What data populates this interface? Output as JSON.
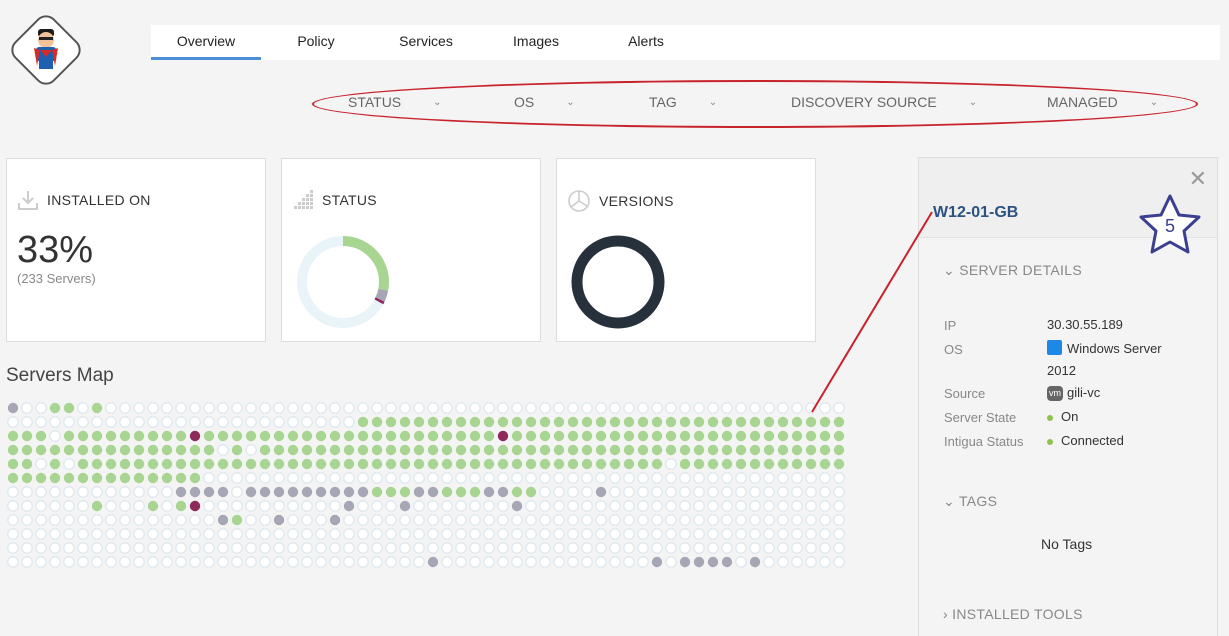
{
  "tabs": [
    {
      "label": "Overview",
      "active": true
    },
    {
      "label": "Policy"
    },
    {
      "label": "Services"
    },
    {
      "label": "Images"
    },
    {
      "label": "Alerts"
    }
  ],
  "filters": [
    {
      "label": "STATUS"
    },
    {
      "label": "OS"
    },
    {
      "label": "TAG"
    },
    {
      "label": "DISCOVERY SOURCE"
    },
    {
      "label": "MANAGED"
    }
  ],
  "cards": {
    "installed": {
      "title": "INSTALLED ON",
      "percent": "33%",
      "servers": "(233 Servers)"
    },
    "status": {
      "title": "STATUS",
      "chart": {
        "green": 0.28,
        "gray": 0.04,
        "purple": 0.01,
        "rest": "#e8f4f7"
      }
    },
    "versions": {
      "title": "VERSIONS"
    }
  },
  "map": {
    "title": "Servers Map",
    "colors": {
      "g": "#a8d591",
      "r": "#a7a6b5",
      "p": "#8e2a5a",
      "e": "#dde8ee",
      "s": "#a8d591"
    },
    "rows": [
      "r..gg.g.............................................................",
      ".........................gggggggggggggggggggggggggggggggggggggsg",
      "ggg.gggggggggpgggggggggggggggggggggpgggggggggggggggggggggggggggg",
      "ggggggggggggggg.g.gggggggggggggggggggggggggggggggggggggggggggggg",
      "gg.g.gggggggggggggggggggggggggggggggggggggggggg.gggggggggggggggg",
      "gggggggggggggg..................................................",
      "............rrrr.rrrrrrrrrgggrrgggrrgg....r.................r",
      "......g...g.gp..........r...r.......r...........................",
      "...............rg..r...r........................................",
      "................................................................",
      "................................................................",
      "..............................r...............r.rrrr.r.........."
    ]
  },
  "panel": {
    "server_name": "W12-01-GB",
    "badge": "5",
    "details_header": "SERVER DETAILS",
    "details": {
      "ip_label": "IP",
      "ip": "30.30.55.189",
      "os_label": "OS",
      "os_line1": "Windows Server",
      "os_line2": "2012",
      "source_label": "Source",
      "source": "gili-vc",
      "vm_badge": "vm",
      "state_label": "Server State",
      "state": "On",
      "intigua_label": "Intigua Status",
      "intigua": "Connected"
    },
    "tags_header": "TAGS",
    "no_tags": "No Tags",
    "tools_header": "INSTALLED TOOLS"
  },
  "icons": [
    "download-icon",
    "signal-bars-icon",
    "pie-chart-icon",
    "close-icon",
    "chevron-down-icon",
    "windows-icon",
    "vm-icon",
    "star-icon",
    "superman-avatar"
  ]
}
